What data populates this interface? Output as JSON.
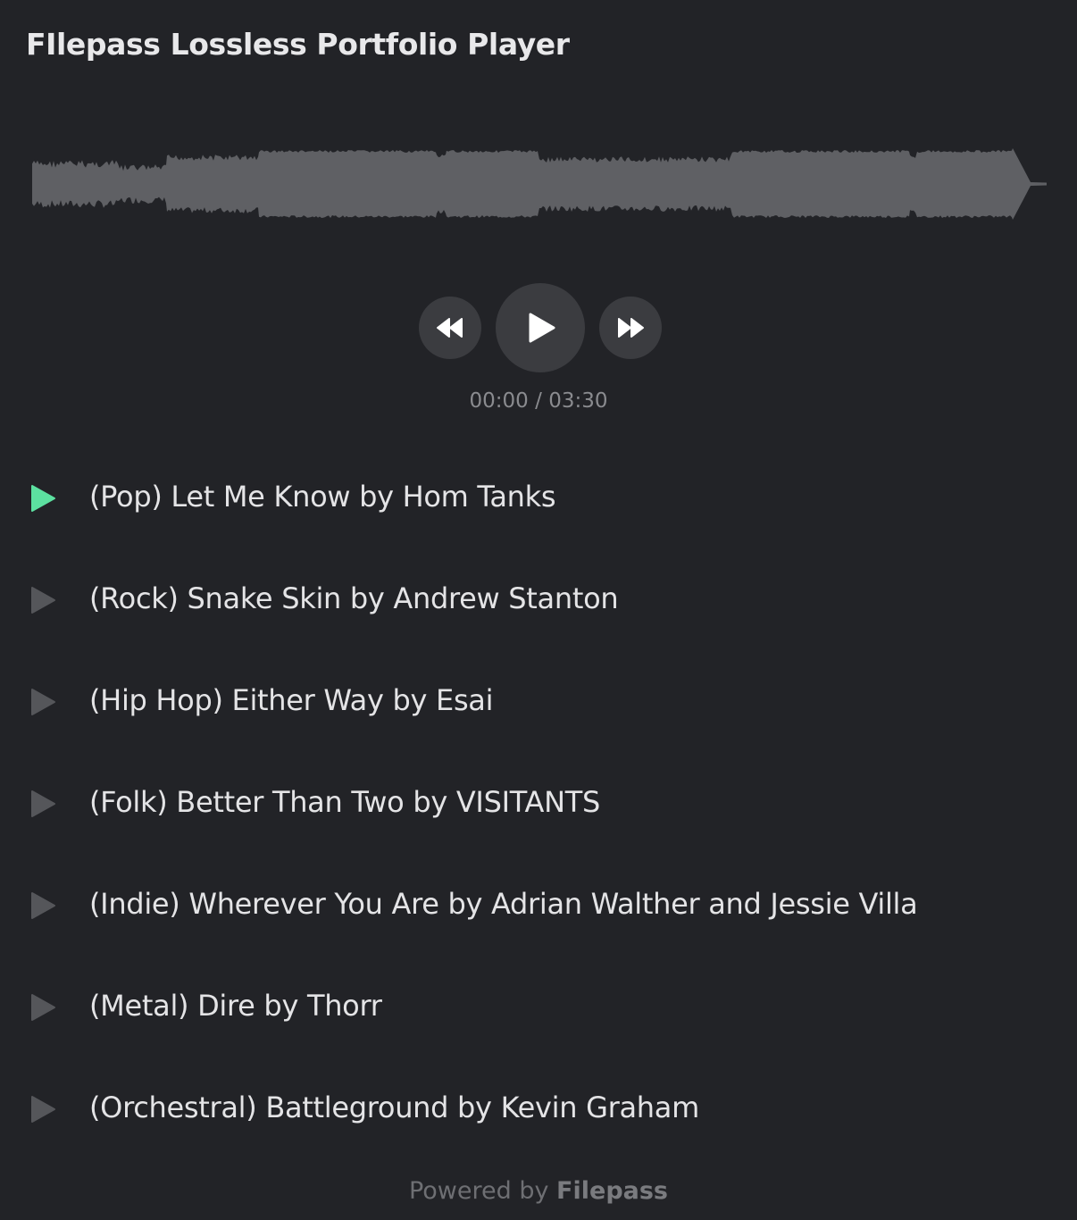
{
  "app": {
    "title": "FIlepass Lossless Portfolio Player"
  },
  "player": {
    "current_time": "00:00",
    "separator": " / ",
    "duration": "03:30",
    "progress": 0
  },
  "tracks": [
    {
      "label": "(Pop) Let Me Know by Hom Tanks",
      "active": true
    },
    {
      "label": "(Rock) Snake Skin by Andrew Stanton",
      "active": false
    },
    {
      "label": "(Hip Hop) Either Way by Esai",
      "active": false
    },
    {
      "label": "(Folk) Better Than Two by VISITANTS",
      "active": false
    },
    {
      "label": "(Indie) Wherever You Are by Adrian Walther and Jessie Villa",
      "active": false
    },
    {
      "label": "(Metal) Dire by Thorr",
      "active": false
    },
    {
      "label": "(Orchestral) Battleground by Kevin Graham",
      "active": false
    }
  ],
  "footer": {
    "prefix": "Powered by ",
    "brand": "Filepass"
  },
  "colors": {
    "background": "#222327",
    "waveform": "#5f6064",
    "active_play": "#5ce0a0",
    "inactive_play": "#55565a",
    "button_bg": "#3b3c40"
  },
  "icons": {
    "rewind": "rewind-icon",
    "play": "play-icon",
    "fast_forward": "fast-forward-icon",
    "track_play": "play-icon"
  }
}
